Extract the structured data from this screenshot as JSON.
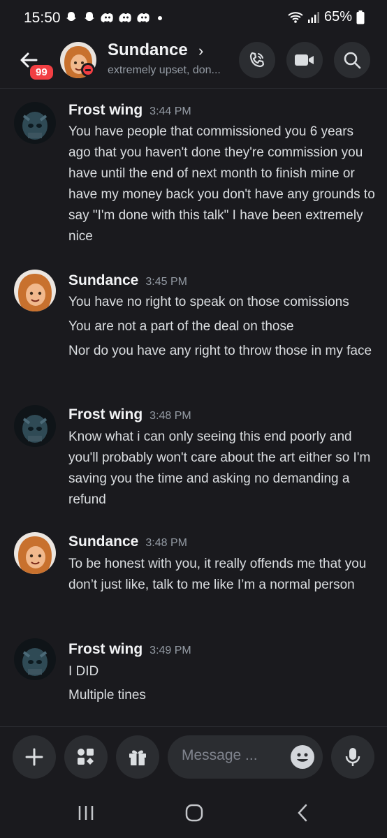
{
  "status_bar": {
    "time": "15:50",
    "battery": "65%",
    "notification_icons": [
      "snapchat-icon",
      "snapchat-icon",
      "discord-icon",
      "discord-icon",
      "discord-icon"
    ]
  },
  "header": {
    "unread_badge": "99",
    "name": "Sundance",
    "chevron": "›",
    "status_text": "extremely upset, don...",
    "status": "do-not-disturb"
  },
  "messages": [
    {
      "author": "Frost wing",
      "time": "3:44 PM",
      "avatar": "frost-wing-avatar",
      "lines": [
        "You have people that commissioned you 6 years ago that you haven't done they're commission you have until the end of next month to finish mine or have my money back you don't have any grounds to say \"I'm done with this talk\" I have been extremely nice"
      ]
    },
    {
      "author": "Sundance",
      "time": "3:45 PM",
      "avatar": "sundance-avatar",
      "lines": [
        "You have no right to speak on those comissions",
        "You are not a part of the deal on those",
        "Nor do you have any right to throw those in my face"
      ]
    },
    {
      "author": "Frost wing",
      "time": "3:48 PM",
      "avatar": "frost-wing-avatar",
      "lines": [
        "Know what i can only seeing this end poorly and you'll probably won't care about the art either so I'm saving you the time and asking no demanding a refund"
      ]
    },
    {
      "author": "Sundance",
      "time": "3:48 PM",
      "avatar": "sundance-avatar",
      "lines": [
        "To be honest with you, it really offends me that you don’t just like, talk to me like I’m a normal person"
      ]
    },
    {
      "author": "Frost wing",
      "time": "3:49 PM",
      "avatar": "frost-wing-avatar",
      "lines": [
        "I DID",
        "Multiple tines"
      ]
    }
  ],
  "composer": {
    "placeholder": "Message ..."
  },
  "colors": {
    "background": "#1a1a1e",
    "button_bg": "#2b2d31",
    "badge_red": "#f23f43"
  }
}
